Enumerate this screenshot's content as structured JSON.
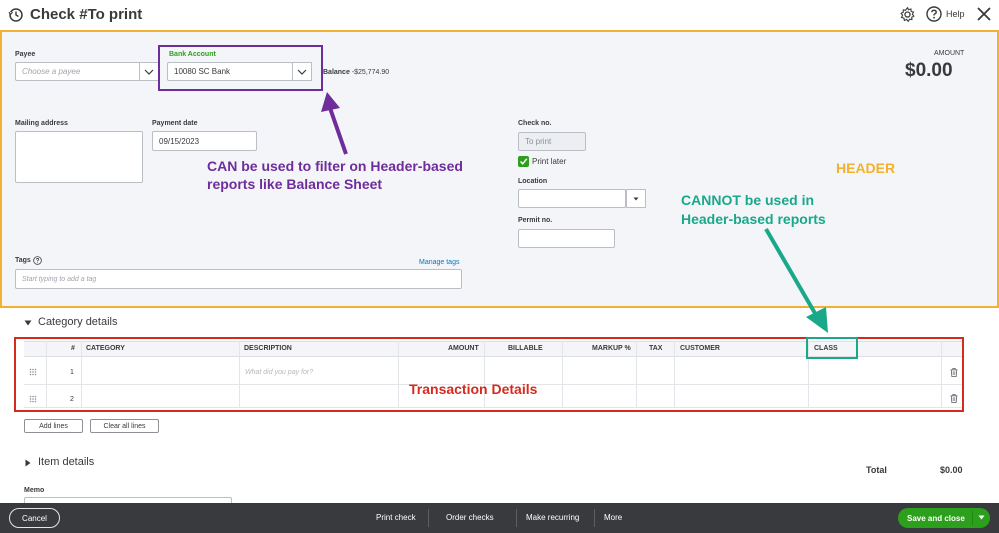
{
  "title": "Check #To print",
  "help_label": "Help",
  "header": {
    "payee_label": "Payee",
    "payee_placeholder": "Choose a payee",
    "bank_label": "Bank Account",
    "bank_value": "10080 SC Bank",
    "balance_label": "Balance",
    "balance_value": "-$25,774.90",
    "amount_label": "AMOUNT",
    "amount_value": "$0.00",
    "mailing_label": "Mailing address",
    "payment_date_label": "Payment date",
    "payment_date_value": "09/15/2023",
    "check_no_label": "Check no.",
    "check_no_value": "To print",
    "print_later_label": "Print later",
    "location_label": "Location",
    "permit_label": "Permit no.",
    "tags_label": "Tags",
    "manage_tags": "Manage tags",
    "tags_placeholder": "Start typing to add a tag"
  },
  "annotations": {
    "header_word": "HEADER",
    "can_line1": "CAN be used to filter on Header-based",
    "can_line2": "reports like Balance Sheet",
    "cannot_line1": "CANNOT be used in",
    "cannot_line2": "Header-based reports",
    "transaction_details": "Transaction Details",
    "colors": {
      "header": "#f2b130",
      "purple": "#6f2c9b",
      "teal": "#19a88a",
      "red": "#d52b1e"
    }
  },
  "category": {
    "title": "Category details",
    "columns": [
      "#",
      "CATEGORY",
      "DESCRIPTION",
      "AMOUNT",
      "BILLABLE",
      "MARKUP %",
      "TAX",
      "CUSTOMER",
      "CLASS"
    ],
    "rows": [
      {
        "num": "1",
        "description_placeholder": "What did you pay for?"
      },
      {
        "num": "2",
        "description_placeholder": ""
      }
    ],
    "add_lines": "Add lines",
    "clear_lines": "Clear all lines"
  },
  "item_details_title": "Item details",
  "total_label": "Total",
  "total_value": "$0.00",
  "memo_label": "Memo",
  "footer": {
    "cancel": "Cancel",
    "print_check": "Print check",
    "order_checks": "Order checks",
    "make_recurring": "Make recurring",
    "more": "More",
    "save_close": "Save and close"
  }
}
